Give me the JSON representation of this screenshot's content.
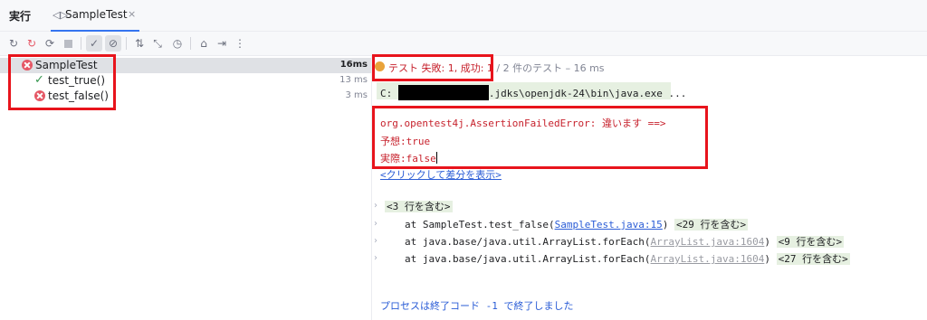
{
  "tabbar": {
    "run_title": "実行",
    "tab_label": "SampleTest",
    "tab_icon": "◁▷",
    "close_glyph": "×"
  },
  "toolbar": {
    "buttons": [
      "rerun-icon",
      "rerun-failed-icon",
      "toggle-auto-test-icon",
      "stop-icon",
      "show-passed-icon",
      "show-ignored-icon",
      "sort-icon",
      "collapse-icon",
      "history-icon",
      "export-icon",
      "import-icon",
      "more-icon"
    ]
  },
  "tree": [
    {
      "name": "SampleTest",
      "status": "failed",
      "duration": "16ms"
    },
    {
      "name": "test_true()",
      "status": "passed",
      "duration": "13 ms"
    },
    {
      "name": "test_false()",
      "status": "failed",
      "duration": "3 ms"
    }
  ],
  "status_bar": {
    "fail_text": "テスト 失敗: 1, 成功: 1",
    "rest_text": "/ 2 件のテスト – 16 ms"
  },
  "console": {
    "cmd_prefix": "C:",
    "cmd_suffix": ".jdks\\openjdk-24\\bin\\java.exe ...",
    "error_line": "org.opentest4j.AssertionFailedError: 違います ==>",
    "expected": "予想:true",
    "actual": "実際:false",
    "diff_link": "<クリックして差分を表示>",
    "fold1": "<3 行を含む>",
    "frames": [
      {
        "prefix": "at SampleTest.test_false(",
        "link": "SampleTest.java:15",
        "suffix": ")",
        "fold": "<29 行を含む>"
      },
      {
        "prefix": "at java.base/java.util.ArrayList.forEach(",
        "link": "ArrayList.java:1604",
        "suffix": ")",
        "fold": "<9 行を含む>"
      },
      {
        "prefix": "at java.base/java.util.ArrayList.forEach(",
        "link": "ArrayList.java:1604",
        "suffix": ")",
        "fold": "<27 行を含む>"
      }
    ],
    "exit_text": "プロセスは終了コード -1 で終了しました"
  },
  "colors": {
    "fail": "#e55765",
    "pass": "#369650",
    "highlight_box": "#e8141c",
    "link": "#2a5cd6"
  }
}
